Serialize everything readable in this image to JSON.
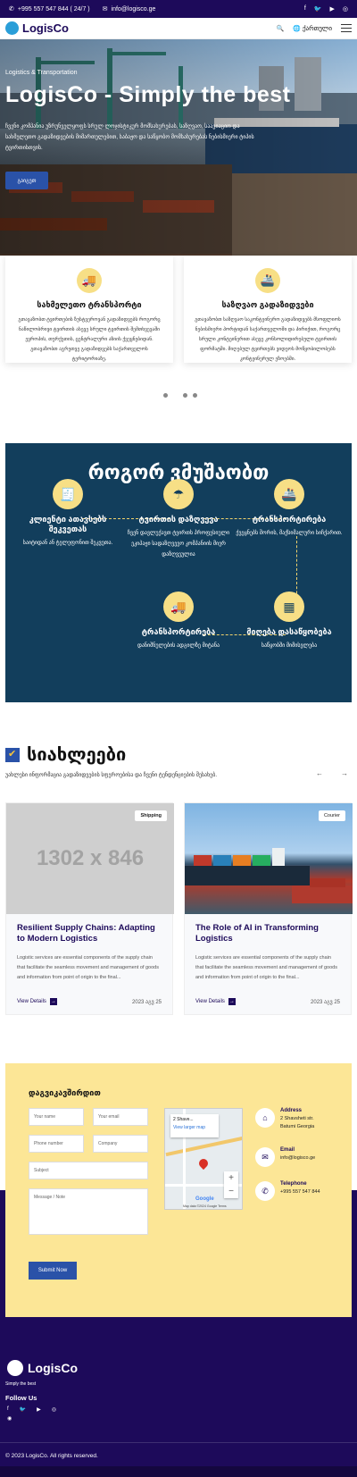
{
  "topbar": {
    "phone": "+995 557 547 844 ( 24/7 )",
    "email": "info@logisco.ge",
    "socials": [
      "facebook-icon",
      "twitter-icon",
      "youtube-icon",
      "instagram-icon"
    ]
  },
  "nav": {
    "brand": "LogisCo",
    "language": "ქართული"
  },
  "hero": {
    "tag": "Logistics & Transportation",
    "title": "LogisCo - Simply the best",
    "description": "ჩვენი კომპანია უზრუნველყოფს სრულ ლოჯისტიკურ მომსახურებას, საზღვაო, საავიაციო და სახმელეთო გადაზიდვების მიმართულებით, საბაჟო და საწყობო მომსახურებას ნებისმიერი ტიპის ტვირთისთვის.",
    "button": "გაიგეთ"
  },
  "services": [
    {
      "title": "სახმელეთო ტრანსპორტი",
      "text": "გთავაზობთ ტვირთების ზუსტვეროვან გადაზიდვებს როგორც ნაწილობრივი ტვირთის ასევე სრული ტვირთის შემთხვევაში ევროპის, თურქეთის, ცენტრალური აზიის ქვეყნებიდან. გთავაზობთ აგრეთვე გადაზიდვებს საქართველოს ტერიტორიაზე."
    },
    {
      "title": "საზღვაო გადაზიდვები",
      "text": "გთავაზობთ საზღვაო საკონტეინერო გადაზიდვებს მსოფლიოს ნებისმიერი პორტიდან საქართველოში და პირიქით, როგორც სრული კონტეინერით ასევე კონსოლიდირებული ტვირთის ფორმატში. მიღებულ ტვირთებს ვიდეოს მოწყობილობებს კონტეინერულ ეზოებში."
    }
  ],
  "how": {
    "title": "როგორ ვმუშაობთ",
    "steps": [
      {
        "title": "კლიენტი ათავსებს შეკვეთას",
        "desc": "საიტიდან ან ტელეფონით შეკვეთა.",
        "icon": "order-icon"
      },
      {
        "title": "ტვირთის დაზღვევა",
        "desc": "ჩვენ დავლუქავთ ტვირთს პროფესიული ეკიპაჟი სადაზღვევო კომპანიის მიერ დაზღვეულია",
        "icon": "insurance-icon"
      },
      {
        "title": "ტრანსპორტირება",
        "desc": "ქვეყნებს შორის, მაქსიმალური სიჩქარით.",
        "icon": "ship-icon"
      },
      {
        "title": "ტრანსპორტირება",
        "desc": "დანიშნულების ადგილზე მიტანა",
        "icon": "truck-icon"
      },
      {
        "title": "მიღება დასაწყობება",
        "desc": "საწყობში მიმისვლება",
        "icon": "container-icon"
      }
    ]
  },
  "news": {
    "title": "სიახლეები",
    "subtitle": "უახლესი ინფორმაცია გადაზიდვების სფეროებისა და ჩვენი ტენდენციების შესახებ.",
    "items": [
      {
        "badge": "Shipping",
        "placeholder": "1302 x 846",
        "title": "Resilient Supply Chains: Adapting to Modern Logistics",
        "text": "Logistic services are essential components of the supply chain that facilitate the seamless movement and management of goods and information from point of origin to the final...",
        "more": "View Details",
        "date": "2023 აგვ 25"
      },
      {
        "badge": "Courier",
        "placeholder": "",
        "title": "The Role of AI in Transforming Logistics",
        "text": "Logistic services are essential components of the supply chain that facilitate the seamless movement and management of goods and information from point of origin to the final...",
        "more": "View Details",
        "date": "2023 აგვ 25"
      }
    ]
  },
  "contact": {
    "title": "დაგვიკავშირდით",
    "fields": {
      "name": "Your name",
      "email": "Your email",
      "phone": "Phone number",
      "company": "Company",
      "subject": "Subject",
      "message": "Message / Note"
    },
    "submit": "Submit Now",
    "map": {
      "place": "2 Shave...",
      "link": "View larger map",
      "attribution": "Map data ©2024 Google   Terms",
      "google": "Google"
    },
    "address_label": "Address",
    "address": "2 Shavsheti str. Batumi Georgia",
    "email_label": "Email",
    "email": "info@logisco.ge",
    "phone_label": "Telephone",
    "phone": "+995 557 547 844"
  },
  "footer": {
    "brand": "LogisCo",
    "slogan": "Simply the best",
    "follow": "Follow Us",
    "copyright": "© 2023 LogisCo. All rights reserved."
  }
}
